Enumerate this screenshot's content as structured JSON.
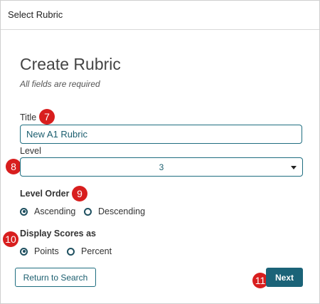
{
  "header": {
    "title": "Select Rubric"
  },
  "form": {
    "heading": "Create Rubric",
    "subtext": "All fields are required",
    "title_label": "Title",
    "title_value": "New A1 Rubric",
    "level_label": "Level",
    "level_value": "3",
    "level_order_label": "Level Order",
    "level_order_options": [
      "Ascending",
      "Descending"
    ],
    "level_order_selected": "Ascending",
    "display_scores_label": "Display Scores as",
    "display_scores_options": [
      "Points",
      "Percent"
    ],
    "display_scores_selected": "Points"
  },
  "buttons": {
    "return_label": "Return to Search",
    "next_label": "Next"
  },
  "callouts": [
    "7",
    "8",
    "9",
    "10",
    "11"
  ],
  "colors": {
    "accent": "#1b6378",
    "callout": "#d81e1e"
  }
}
